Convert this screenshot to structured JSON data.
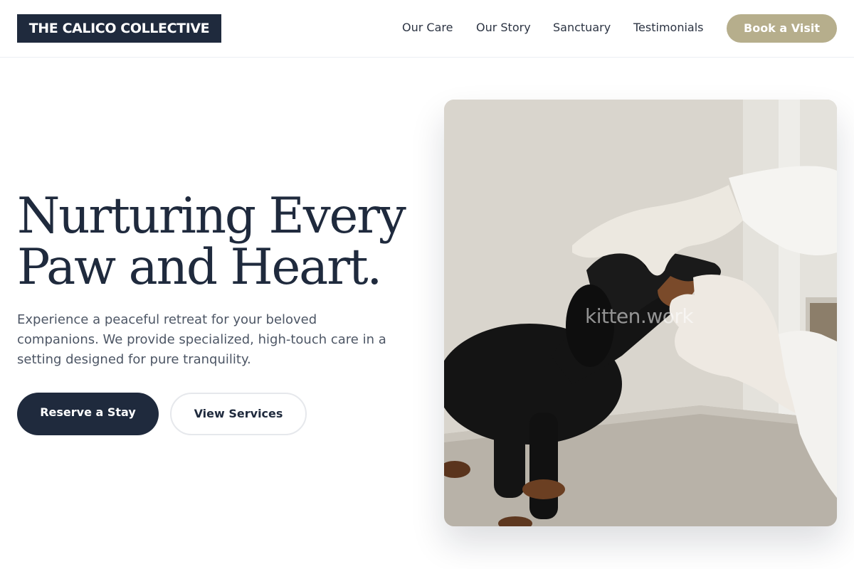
{
  "brand": {
    "name": "THE CALICO COLLECTIVE"
  },
  "nav": {
    "items": [
      {
        "label": "Our Care"
      },
      {
        "label": "Our Story"
      },
      {
        "label": "Sanctuary"
      },
      {
        "label": "Testimonials"
      }
    ],
    "cta_label": "Book a Visit"
  },
  "hero": {
    "title_line1": "Nurturing Every",
    "title_line2": "Paw and Heart.",
    "subtitle": "Experience a peaceful retreat for your beloved companions. We provide specialized, high-touch care in a setting designed for pure tranquility.",
    "primary_label": "Reserve a Stay",
    "secondary_label": "View Services",
    "image_watermark": "kitten.work"
  },
  "colors": {
    "navy": "#1f2a3d",
    "accent_khaki": "#b6ae8c",
    "text_muted": "#4d5665",
    "border": "#e6e8ec"
  }
}
